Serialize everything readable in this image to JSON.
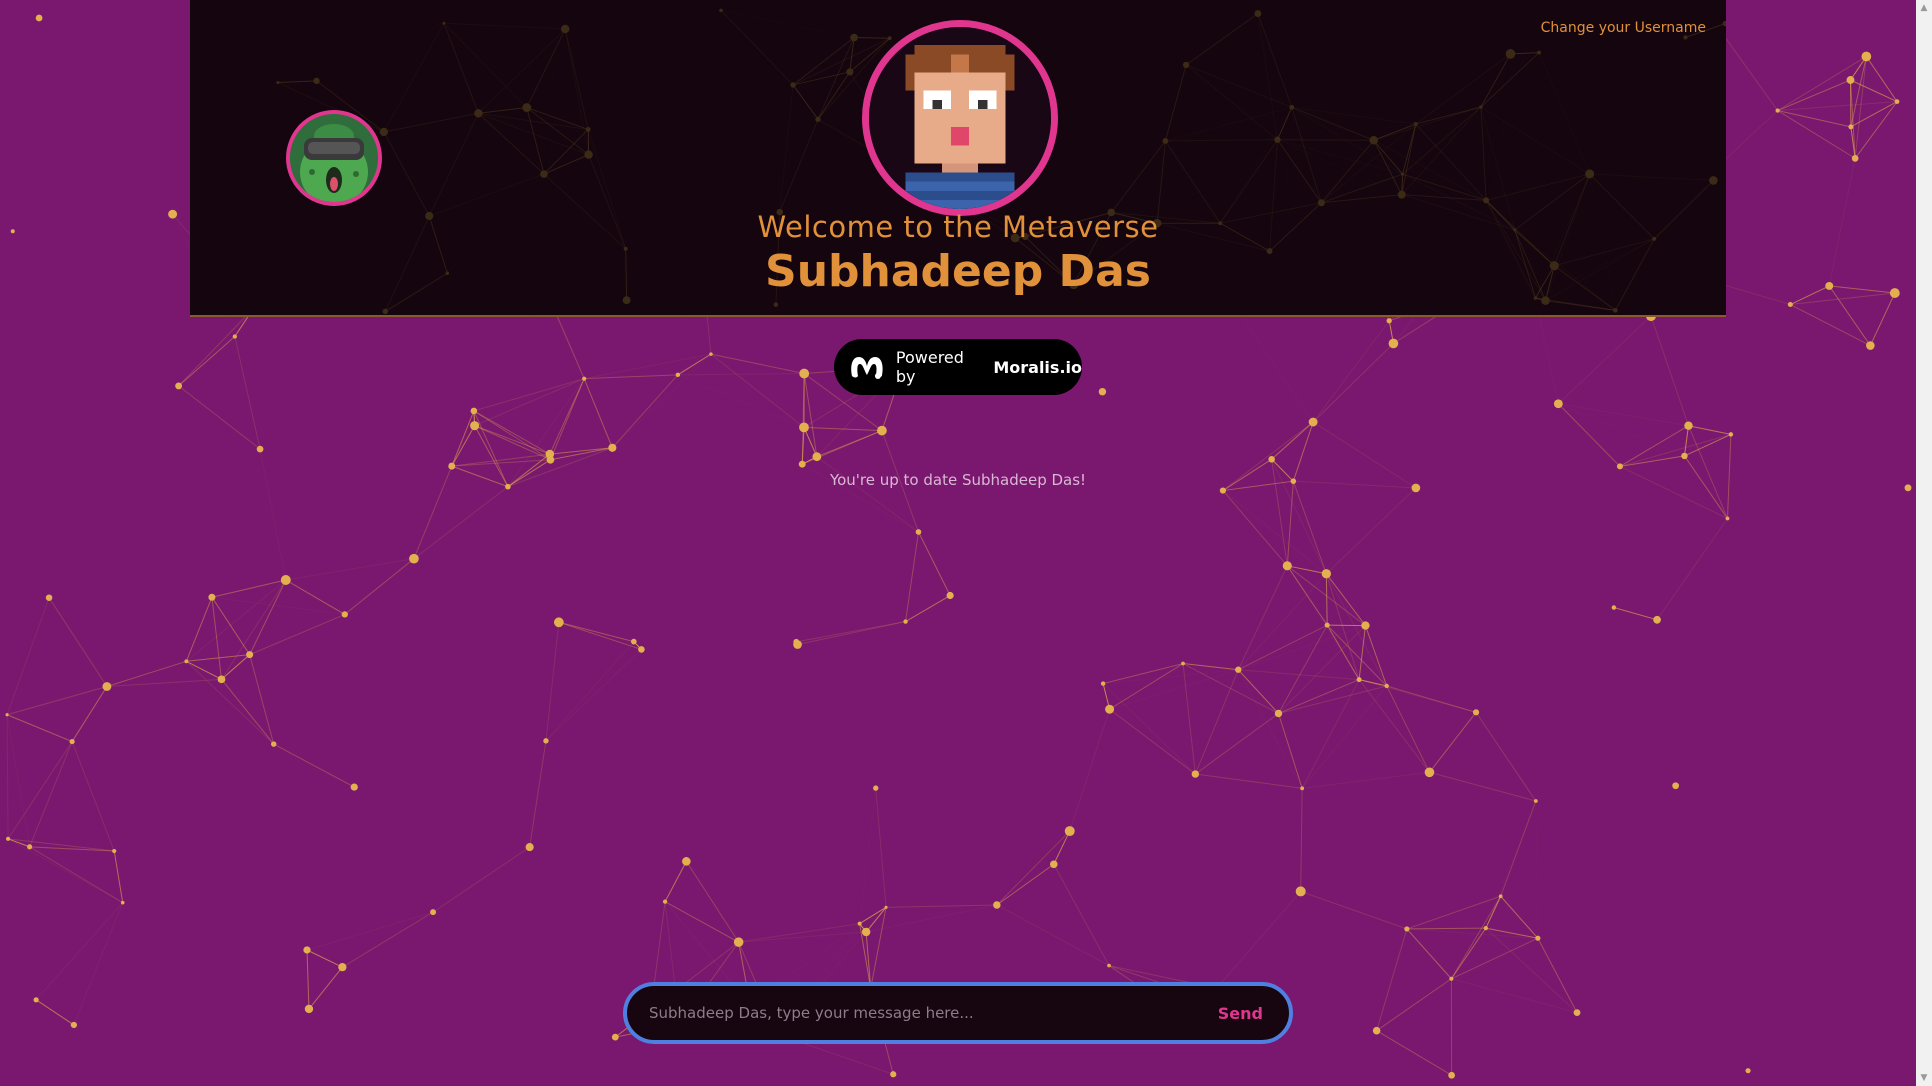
{
  "header": {
    "change_username_link": "Change your Username",
    "welcome_text": "Welcome to the Metaverse",
    "username": "Subhadeep Das"
  },
  "badge": {
    "powered_by": "Powered by",
    "brand": "Moralis.io"
  },
  "status": {
    "message": "You're up to date Subhadeep Das!"
  },
  "chat": {
    "placeholder": "Subhadeep Das, type your message here...",
    "send_label": "Send"
  },
  "colors": {
    "background": "#7a186f",
    "header_bg": "#14050f",
    "accent_orange": "#e0913a",
    "accent_pink": "#e0368f",
    "input_border": "#4f7fe0"
  }
}
